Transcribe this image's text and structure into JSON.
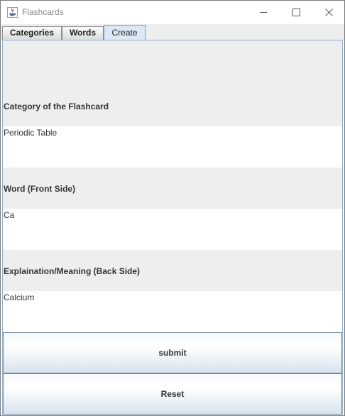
{
  "window": {
    "title": "Flashcards"
  },
  "tabs": [
    {
      "label": "Categories"
    },
    {
      "label": "Words"
    },
    {
      "label": "Create",
      "selected": true
    }
  ],
  "form": {
    "category_label": "Category of the Flashcard",
    "category_value": "Periodic Table",
    "word_label": "Word (Front Side)",
    "word_value": "Ca",
    "meaning_label": "Explaination/Meaning (Back Side)",
    "meaning_value": "Calcium",
    "submit_label": "submit",
    "reset_label": "Reset"
  },
  "icons": {
    "app": "java-cup-icon",
    "minimize": "minimize-icon",
    "maximize": "maximize-icon",
    "close": "close-icon"
  },
  "colors": {
    "selected_tab": "#dce8f3",
    "panel_border": "#8fb0d3",
    "button_gradient_bottom": "#d7e3ee"
  }
}
